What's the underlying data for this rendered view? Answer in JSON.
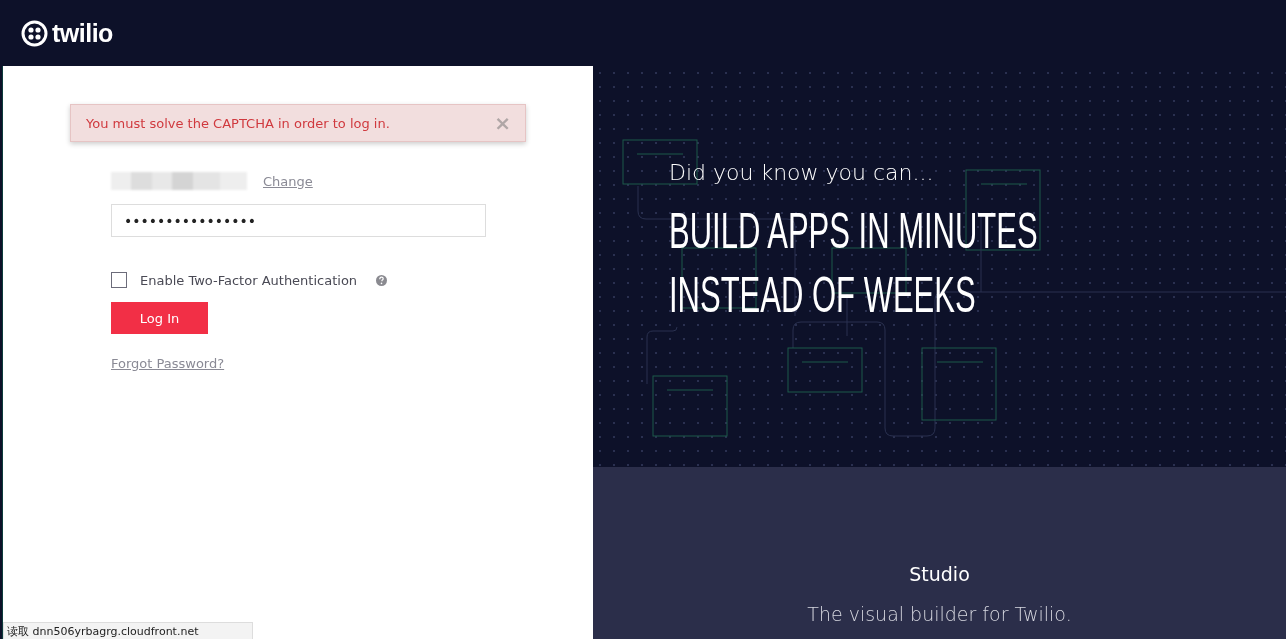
{
  "header": {
    "logo_text": "twilio"
  },
  "alert": {
    "message": "You must solve the CAPTCHA in order to log in.",
    "close": "×"
  },
  "login": {
    "change_link": "Change",
    "password": {
      "value": "••••••••••••••••"
    },
    "two_factor": {
      "label": "Enable Two-Factor Authentication",
      "checked": false
    },
    "submit": "Log In",
    "forgot_link": "Forgot Password?"
  },
  "promo": {
    "kicker": "Did you know you can...",
    "headline": "BUILD APPS IN MINUTES INSTEAD OF WEEKS"
  },
  "product": {
    "title": "Studio",
    "subtitle": "The visual builder for Twilio."
  },
  "status_bar": "读取 dnn506yrbagrg.cloudfront.net"
}
